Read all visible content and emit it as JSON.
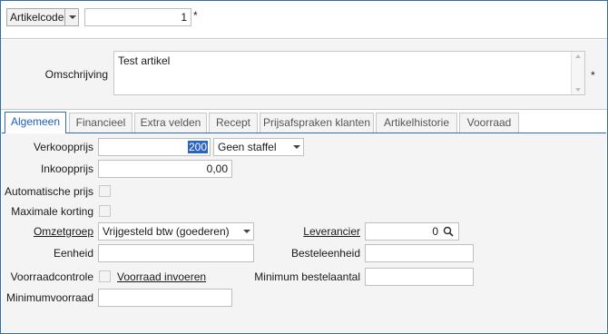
{
  "header": {
    "key_dropdown_label": "Artikelcode",
    "key_value": "1",
    "required_mark": "*"
  },
  "description": {
    "label": "Omschrijving",
    "value": "Test artikel",
    "required_mark": "*"
  },
  "tabs": [
    {
      "label": "Algemeen",
      "active": true
    },
    {
      "label": "Financieel",
      "active": false
    },
    {
      "label": "Extra velden",
      "active": false
    },
    {
      "label": "Recept",
      "active": false
    },
    {
      "label": "Prijsafspraken klanten",
      "active": false
    },
    {
      "label": "Artikelhistorie",
      "active": false
    },
    {
      "label": "Voorraad",
      "active": false
    }
  ],
  "form": {
    "verkoopprijs_label": "Verkoopprijs",
    "verkoopprijs_value": "200",
    "staffel_value": "Geen staffel",
    "inkoopprijs_label": "Inkoopprijs",
    "inkoopprijs_value": "0,00",
    "automatische_prijs_label": "Automatische prijs",
    "maximale_korting_label": "Maximale korting",
    "omzetgroep_label": "Omzetgroep",
    "omzetgroep_value": "Vrijgesteld btw (goederen)",
    "eenheid_label": "Eenheid",
    "eenheid_value": "",
    "voorraadcontrole_label": "Voorraadcontrole",
    "voorraad_invoeren_link": "Voorraad invoeren",
    "minimumvoorraad_label": "Minimumvoorraad",
    "minimumvoorraad_value": "",
    "leverancier_label": "Leverancier",
    "leverancier_value": "0",
    "besteleenheid_label": "Besteleenheid",
    "besteleenheid_value": "",
    "minimum_bestelaantal_label": "Minimum bestelaantal",
    "minimum_bestelaantal_value": ""
  },
  "colors": {
    "accent": "#2f6db3",
    "selection": "#2b64c5",
    "panel_bg": "#f4f4f4"
  }
}
